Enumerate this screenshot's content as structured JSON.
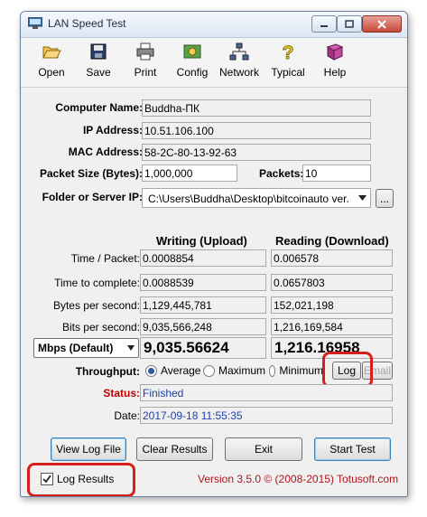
{
  "window": {
    "title": "LAN Speed Test"
  },
  "toolbar": {
    "items": [
      "Open",
      "Save",
      "Print",
      "Config",
      "Network",
      "Typical",
      "Help"
    ]
  },
  "info": {
    "computer_name_label": "Computer Name:",
    "computer_name": "Buddha-ПК",
    "ip_label": "IP Address:",
    "ip": "10.51.106.100",
    "mac_label": "MAC Address:",
    "mac": "58-2C-80-13-92-63",
    "packet_size_label": "Packet Size (Bytes):",
    "packet_size": "1,000,000",
    "packets_label": "Packets:",
    "packets": "10",
    "folder_label": "Folder or Server IP:",
    "folder": "C:\\Users\\Buddha\\Desktop\\bitcoinauto ver.",
    "browse_label": "..."
  },
  "results": {
    "writing_header": "Writing (Upload)",
    "reading_header": "Reading (Download)",
    "rows": [
      {
        "label": "Time / Packet:",
        "write": "0.0008854",
        "read": "0.006578"
      },
      {
        "label": "Time to complete:",
        "write": "0.0088539",
        "read": "0.0657803"
      },
      {
        "label": "Bytes per second:",
        "write": "1,129,445,781",
        "read": "152,021,198"
      },
      {
        "label": "Bits per second:",
        "write": "9,035,566,248",
        "read": "1,216,169,584"
      }
    ],
    "unit_select": "Mbps (Default)",
    "write_big": "9,035.56624",
    "read_big": "1,216.16958"
  },
  "throughput": {
    "label": "Throughput:",
    "options": [
      "Average",
      "Maximum",
      "Minimum"
    ],
    "selected": "Average",
    "log_label": "Log",
    "email_label": "Email"
  },
  "status": {
    "label": "Status:",
    "value": "Finished"
  },
  "date": {
    "label": "Date:",
    "value": "2017-09-18 11:55:35"
  },
  "buttons": {
    "view_log": "View Log File",
    "clear": "Clear Results",
    "exit": "Exit",
    "start": "Start Test"
  },
  "log_results": {
    "label": "Log Results",
    "checked": true
  },
  "footer": {
    "version": "Version 3.5.0  © (2008-2015) Totusoft.com"
  },
  "colors": {
    "highlight": "#d3201c",
    "status_red": "#c00000",
    "value_blue": "#1f3fa6",
    "version_red": "#b0141a"
  }
}
